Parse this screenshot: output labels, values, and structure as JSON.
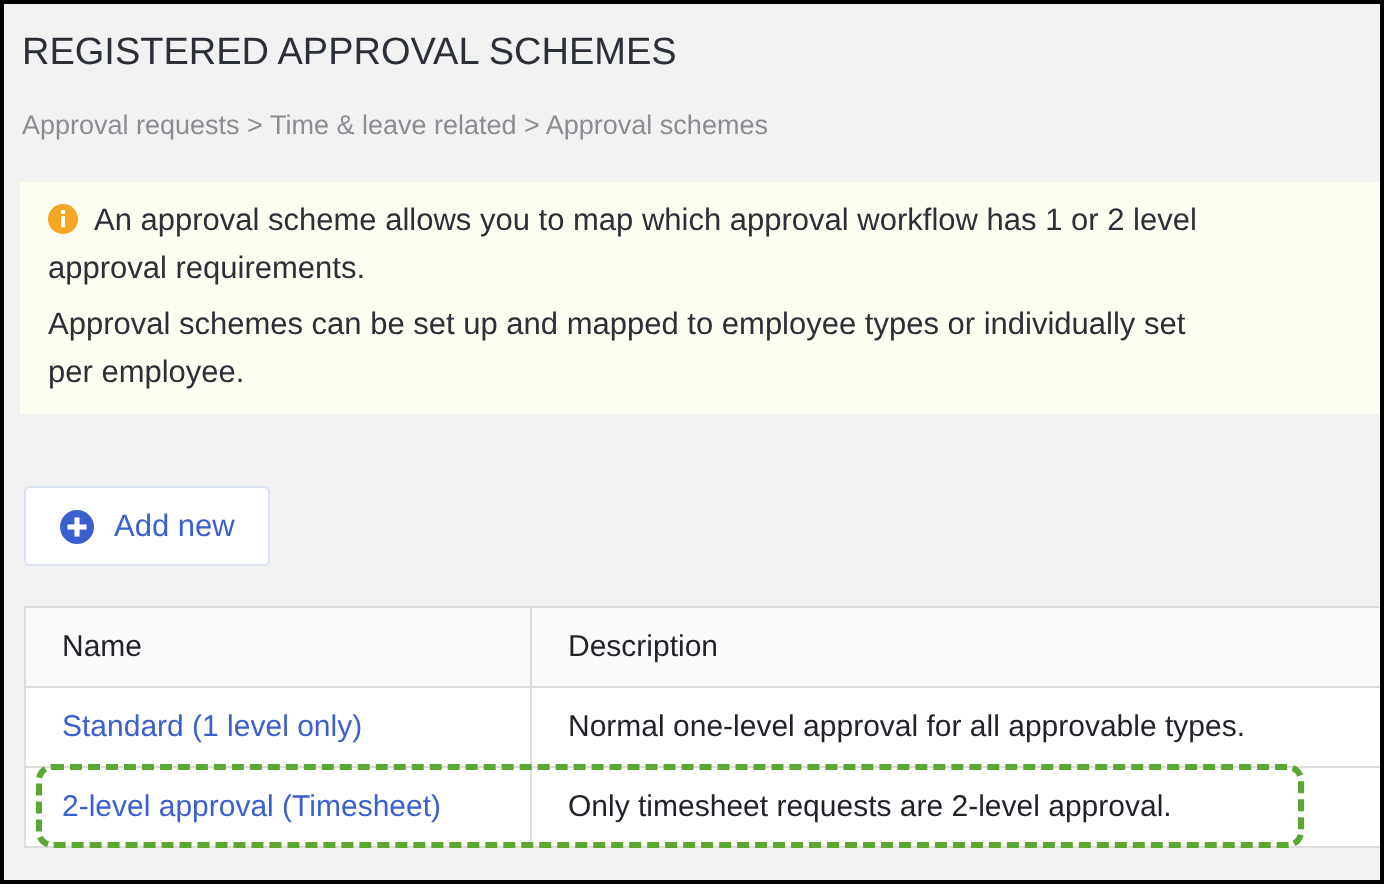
{
  "title": "REGISTERED APPROVAL SCHEMES",
  "breadcrumb": "Approval requests > Time & leave related > Approval schemes",
  "info": {
    "paragraphs": [
      "An approval scheme allows you to map which approval workflow has 1 or 2 level approval requirements.",
      "Approval schemes can be set up and mapped to employee types or individually set per employee."
    ]
  },
  "add_button": "Add new",
  "table": {
    "columns": [
      "Name",
      "Description"
    ],
    "rows": [
      {
        "name": "Standard (1 level only)",
        "description": "Normal one-level approval for all approvable types.",
        "highlighted": false
      },
      {
        "name": "2-level approval (Timesheet)",
        "description": "Only timesheet requests are 2-level approval.",
        "highlighted": true
      }
    ]
  }
}
